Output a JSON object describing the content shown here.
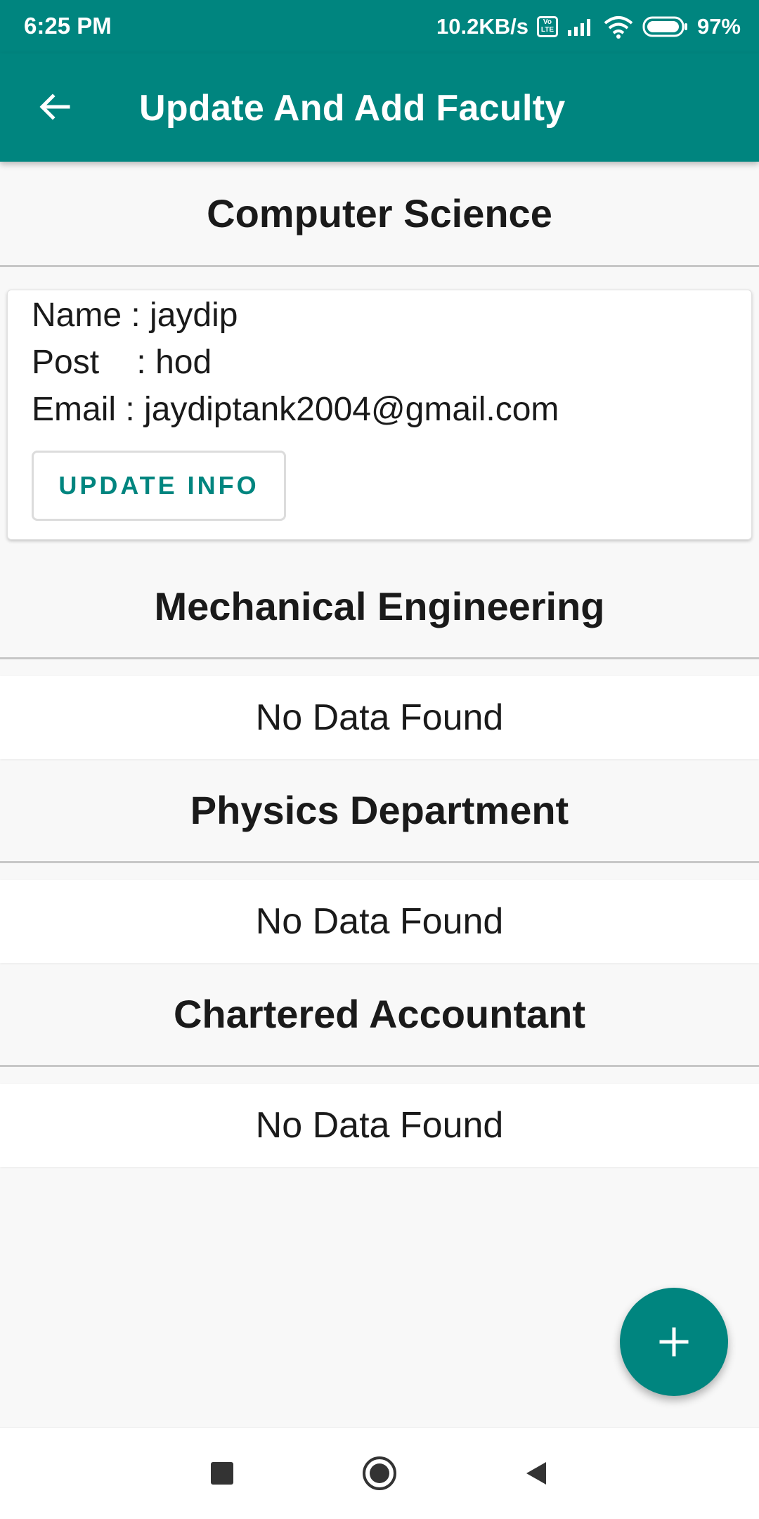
{
  "status_bar": {
    "time": "6:25 PM",
    "network_speed": "10.2KB/s",
    "volte_label": "Vo LTE",
    "battery_percent": "97%",
    "battery_level": 0.97,
    "icons": [
      "volte-icon",
      "signal-icon",
      "wifi-icon",
      "battery-icon"
    ]
  },
  "app_bar": {
    "title": "Update And Add Faculty",
    "back_icon": "arrow-back-icon"
  },
  "departments": [
    {
      "name": "Computer Science",
      "faculty": {
        "name_line": "Name : jaydip",
        "post_line": "Post    : hod",
        "email_line": "Email : jaydiptank2004@gmail.com",
        "update_label": "UPDATE INFO"
      }
    },
    {
      "name": "Mechanical Engineering",
      "empty_text": "No Data Found"
    },
    {
      "name": "Physics Department",
      "empty_text": "No Data Found"
    },
    {
      "name": "Chartered Accountant",
      "empty_text": "No Data Found"
    }
  ],
  "fab": {
    "icon": "plus-icon"
  },
  "nav_bar": {
    "icons": [
      "recents-square-icon",
      "home-circle-icon",
      "back-triangle-icon"
    ]
  },
  "colors": {
    "primary": "#00857f",
    "background": "#f8f8f8",
    "card": "#ffffff",
    "text": "#1a1a1a"
  }
}
